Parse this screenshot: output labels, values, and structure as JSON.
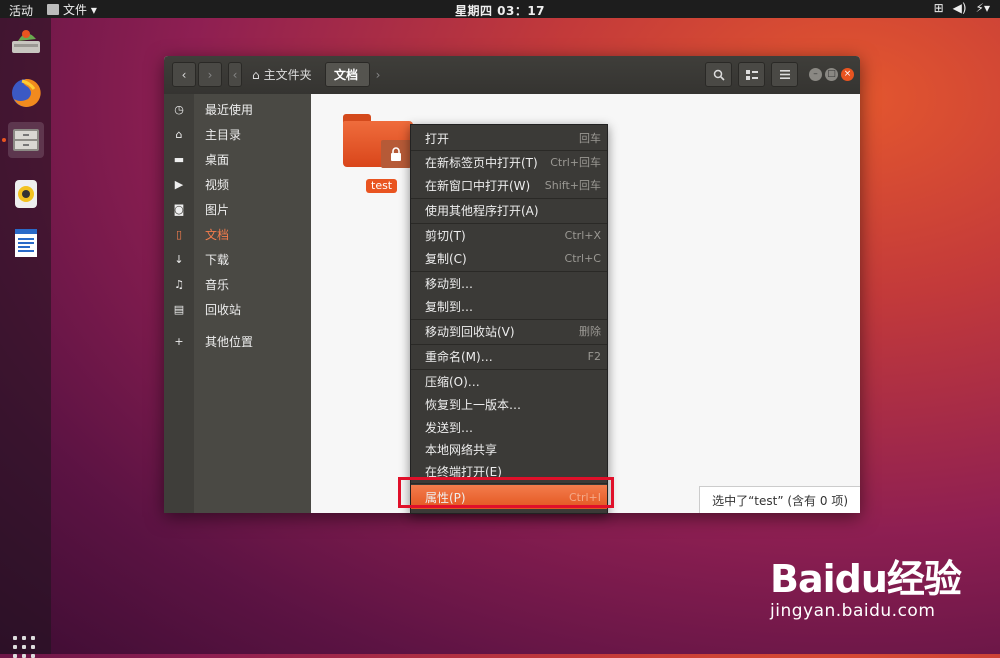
{
  "topbar": {
    "activities": "活动",
    "app_menu": "文件 ▾",
    "clock": "星期四 03：17",
    "tray": {
      "network": "⊞",
      "volume": "◀)",
      "power": "⚡▾"
    }
  },
  "dock": {
    "items": [
      "disk-install-icon",
      "firefox-icon",
      "files-icon",
      "rhythmbox-icon",
      "libreoffice-writer-icon"
    ]
  },
  "window": {
    "breadcrumbs": {
      "home": "主文件夹",
      "current": "文档"
    },
    "sidebar": {
      "items": [
        {
          "icon": "◷",
          "label": "最近使用"
        },
        {
          "icon": "⌂",
          "label": "主目录"
        },
        {
          "icon": "▬",
          "label": "桌面"
        },
        {
          "icon": "▶",
          "label": "视频"
        },
        {
          "icon": "◙",
          "label": "图片"
        },
        {
          "icon": "▯",
          "label": "文档"
        },
        {
          "icon": "↓",
          "label": "下载"
        },
        {
          "icon": "♫",
          "label": "音乐"
        },
        {
          "icon": "▤",
          "label": "回收站"
        },
        {
          "icon": "+",
          "label": "其他位置"
        }
      ]
    },
    "file": {
      "name": "test"
    },
    "status": "选中了“test” (含有 0 项)"
  },
  "context_menu": {
    "items": [
      {
        "label": "打开",
        "shortcut": "回车"
      },
      {
        "label": "在新标签页中打开(T)",
        "shortcut": "Ctrl+回车"
      },
      {
        "label": "在新窗口中打开(W)",
        "shortcut": "Shift+回车"
      },
      {
        "label": "使用其他程序打开(A)",
        "shortcut": ""
      },
      {
        "label": "剪切(T)",
        "shortcut": "Ctrl+X"
      },
      {
        "label": "复制(C)",
        "shortcut": "Ctrl+C"
      },
      {
        "label": "移动到…",
        "shortcut": ""
      },
      {
        "label": "复制到…",
        "shortcut": ""
      },
      {
        "label": "移动到回收站(V)",
        "shortcut": "删除"
      },
      {
        "label": "重命名(M)…",
        "shortcut": "F2"
      },
      {
        "label": "压缩(O)…",
        "shortcut": ""
      },
      {
        "label": "恢复到上一版本…",
        "shortcut": ""
      },
      {
        "label": "发送到…",
        "shortcut": ""
      },
      {
        "label": "本地网络共享",
        "shortcut": ""
      },
      {
        "label": "在终端打开(E)",
        "shortcut": ""
      },
      {
        "label": "属性(P)",
        "shortcut": "Ctrl+I"
      }
    ]
  },
  "watermark": {
    "brand": "Baidu经验",
    "url": "jingyan.baidu.com"
  },
  "colors": {
    "accent": "#e95420",
    "highlight_box": "#e0102a"
  }
}
